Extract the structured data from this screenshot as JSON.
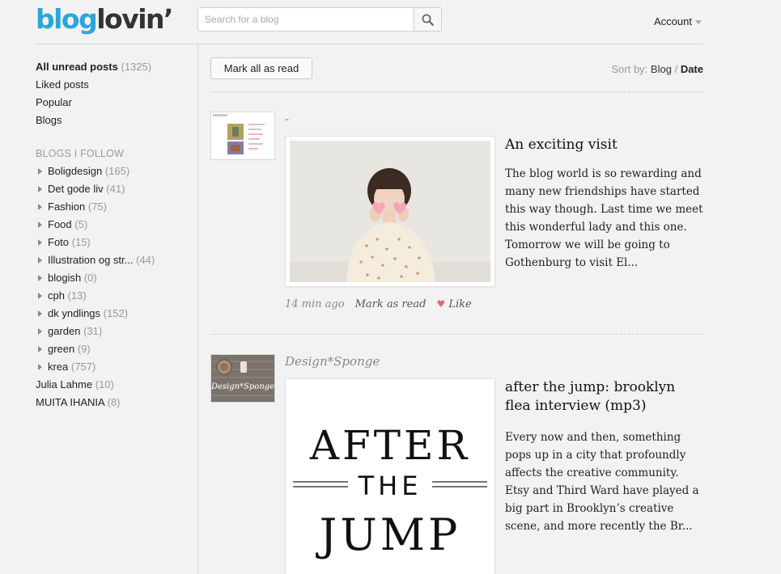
{
  "header": {
    "logo_part1": "blog",
    "logo_part2": "lovin’",
    "search_placeholder": "Search for a blog",
    "account_label": "Account"
  },
  "sidebar": {
    "items": [
      {
        "label": "All unread posts",
        "count": "(1325)"
      },
      {
        "label": "Liked posts"
      },
      {
        "label": "Popular"
      },
      {
        "label": "Blogs"
      }
    ],
    "section_title": "BLOGS I FOLLOW",
    "folders": [
      {
        "label": "Boligdesign",
        "count": "(165)"
      },
      {
        "label": "Det gode liv",
        "count": "(41)"
      },
      {
        "label": "Fashion",
        "count": "(75)"
      },
      {
        "label": "Food",
        "count": "(5)"
      },
      {
        "label": "Foto",
        "count": "(15)"
      },
      {
        "label": "Illustration og str...",
        "count": "(44)"
      },
      {
        "label": "blogish",
        "count": "(0)"
      },
      {
        "label": "cph",
        "count": "(13)"
      },
      {
        "label": "dk yndlings",
        "count": "(152)"
      },
      {
        "label": "garden",
        "count": "(31)"
      },
      {
        "label": "green",
        "count": "(9)"
      },
      {
        "label": "krea",
        "count": "(757)"
      }
    ],
    "blogs": [
      {
        "label": "Julia Lahme",
        "count": "(10)"
      },
      {
        "label": "MUITA IHANIA",
        "count": "(8)"
      }
    ]
  },
  "toolbar": {
    "mark_all_label": "Mark all as read",
    "sort_label": "Sort by:",
    "sort_blog": "Blog",
    "sort_separator": "/",
    "sort_date": "Date"
  },
  "posts": [
    {
      "source": "-",
      "title": "An exciting visit",
      "excerpt": "The blog world is so rewarding and many new friendships have started this way though. Last time we meet this wonderful lady and this one. Tomorrow we will be going to Gothenburg to visit El...",
      "time": "14 min ago",
      "mark_read": "Mark as read",
      "like": "Like"
    },
    {
      "source": "Design*Sponge",
      "title": "after the jump: brooklyn flea interview (mp3)",
      "excerpt": "Every now and then, something pops up in a city that profoundly affects the creative community. Etsy and Third Ward have played a big part in Brooklyn’s creative scene, and more recently the Br...",
      "image_text": [
        "AFTER",
        "THE",
        "JUMP"
      ],
      "thumb_text": "Design*Sponge"
    }
  ],
  "colors": {
    "brand_blue": "#2ca6d9",
    "background": "#f2f2f2",
    "like_heart": "#e36a6a"
  },
  "icons": [
    "search-icon",
    "chevron-down-icon",
    "folder-arrow-icon",
    "heart-icon"
  ]
}
